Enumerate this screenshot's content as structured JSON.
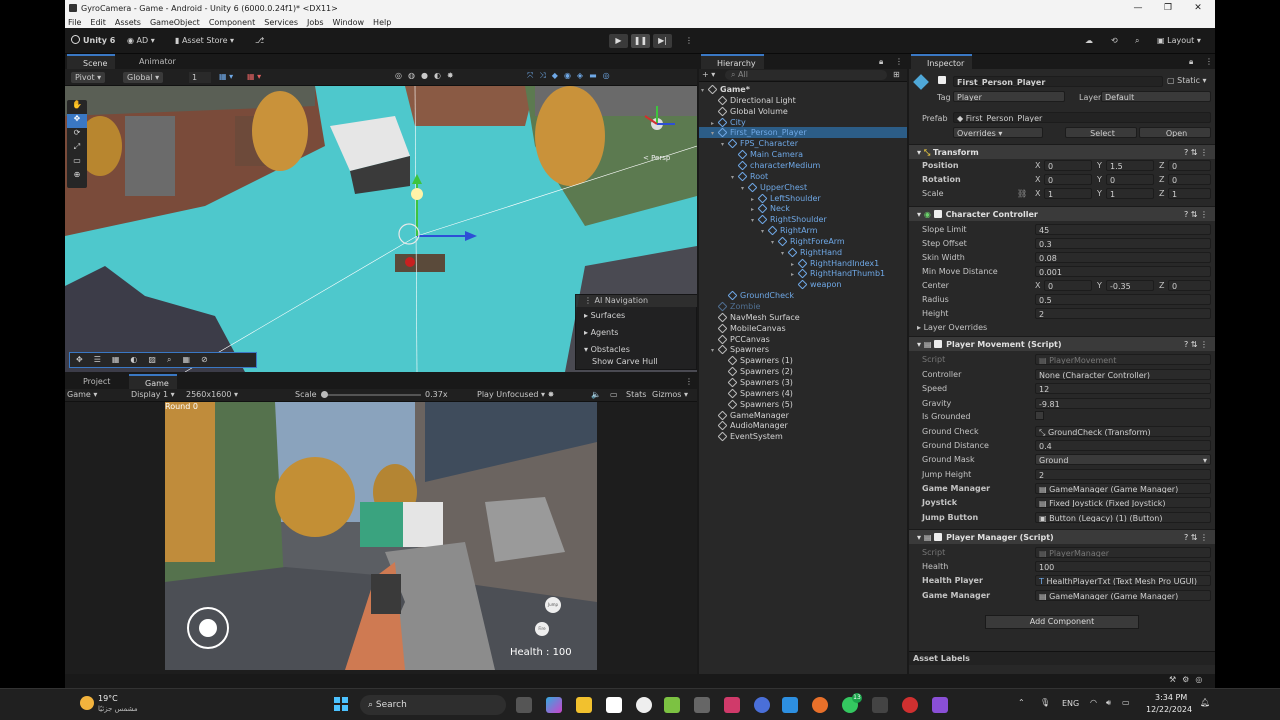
{
  "window": {
    "title": "GyroCamera - Game - Android - Unity 6 (6000.0.24f1)* <DX11>",
    "controls": [
      "—",
      "❐",
      "✕"
    ]
  },
  "menu": [
    "File",
    "Edit",
    "Assets",
    "GameObject",
    "Component",
    "Services",
    "Jobs",
    "Window",
    "Help"
  ],
  "toolbar": {
    "unity_label": "Unity 6",
    "account": "AD",
    "asset_store": "Asset Store",
    "layout": "Layout"
  },
  "scene_panel": {
    "tabs": [
      "Scene",
      "Animator"
    ],
    "pivot": "Pivot",
    "global": "Global",
    "grid_value": "1",
    "persp": "< Persp",
    "ai_nav": {
      "title": "AI Navigation",
      "items": [
        "Surfaces",
        "Agents",
        "Obstacles"
      ],
      "show_carve": "Show Carve Hull"
    }
  },
  "game_panel": {
    "tabs": [
      "Project",
      "Game"
    ],
    "mode": "Game",
    "display": "Display 1",
    "resolution": "2560x1600",
    "scale_label": "Scale",
    "scale_value": "0.37x",
    "play_unfocused": "Play Unfocused",
    "stats": "Stats",
    "gizmos": "Gizmos",
    "hud_round": "Round 0",
    "hud_health": "Health  : 100",
    "btn_jump": "Jump",
    "btn_fire": "Fire"
  },
  "hierarchy": {
    "tab": "Hierarchy",
    "search_placeholder": "All",
    "items": [
      {
        "label": "Game*",
        "depth": 0
      },
      {
        "label": "Directional Light",
        "depth": 1
      },
      {
        "label": "Global Volume",
        "depth": 1
      },
      {
        "label": "City",
        "depth": 1
      },
      {
        "label": "First_Person_Player",
        "depth": 1
      },
      {
        "label": "FPS_Character",
        "depth": 2
      },
      {
        "label": "Main Camera",
        "depth": 3
      },
      {
        "label": "characterMedium",
        "depth": 3
      },
      {
        "label": "Root",
        "depth": 3
      },
      {
        "label": "UpperChest",
        "depth": 4
      },
      {
        "label": "LeftShoulder",
        "depth": 5
      },
      {
        "label": "Neck",
        "depth": 5
      },
      {
        "label": "RightShoulder",
        "depth": 5
      },
      {
        "label": "RightArm",
        "depth": 6
      },
      {
        "label": "RightForeArm",
        "depth": 7
      },
      {
        "label": "RightHand",
        "depth": 8
      },
      {
        "label": "RightHandIndex1",
        "depth": 9
      },
      {
        "label": "RightHandThumb1",
        "depth": 9
      },
      {
        "label": "weapon",
        "depth": 9
      },
      {
        "label": "GroundCheck",
        "depth": 2
      },
      {
        "label": "Zombie",
        "depth": 1
      },
      {
        "label": "NavMesh Surface",
        "depth": 1
      },
      {
        "label": "MobileCanvas",
        "depth": 1
      },
      {
        "label": "PCCanvas",
        "depth": 1
      },
      {
        "label": "Spawners",
        "depth": 1
      },
      {
        "label": "Spawners (1)",
        "depth": 2
      },
      {
        "label": "Spawners (2)",
        "depth": 2
      },
      {
        "label": "Spawners (3)",
        "depth": 2
      },
      {
        "label": "Spawners (4)",
        "depth": 2
      },
      {
        "label": "Spawners (5)",
        "depth": 2
      },
      {
        "label": "GameManager",
        "depth": 1
      },
      {
        "label": "AudioManager",
        "depth": 1
      },
      {
        "label": "EventSystem",
        "depth": 1
      }
    ]
  },
  "inspector": {
    "tab": "Inspector",
    "object_name": "First_Person_Player",
    "static": "Static",
    "tag_label": "Tag",
    "tag_value": "Player",
    "layer_label": "Layer",
    "layer_value": "Default",
    "prefab_label": "Prefab",
    "prefab_value": "First_Person_Player",
    "overrides": "Overrides",
    "select": "Select",
    "open": "Open",
    "transform": {
      "title": "Transform",
      "rows": [
        {
          "label": "Position",
          "x": "0",
          "y": "1.5",
          "z": "0"
        },
        {
          "label": "Rotation",
          "x": "0",
          "y": "0",
          "z": "0"
        },
        {
          "label": "Scale",
          "x": "1",
          "y": "1",
          "z": "1"
        }
      ]
    },
    "character_controller": {
      "title": "Character Controller",
      "slope_limit": [
        "Slope Limit",
        "45"
      ],
      "step_offset": [
        "Step Offset",
        "0.3"
      ],
      "skin_width": [
        "Skin Width",
        "0.08"
      ],
      "min_move": [
        "Min Move Distance",
        "0.001"
      ],
      "center_label": "Center",
      "center": {
        "x": "0",
        "y": "-0.35",
        "z": "0"
      },
      "radius": [
        "Radius",
        "0.5"
      ],
      "height": [
        "Height",
        "2"
      ],
      "layer_overrides": "Layer Overrides"
    },
    "player_movement": {
      "title": "Player Movement (Script)",
      "script": [
        "Script",
        "PlayerMovement"
      ],
      "controller": [
        "Controller",
        "None (Character Controller)"
      ],
      "speed": [
        "Speed",
        "12"
      ],
      "gravity": [
        "Gravity",
        "-9.81"
      ],
      "is_grounded": "Is Grounded",
      "ground_check": [
        "Ground Check",
        "GroundCheck (Transform)"
      ],
      "ground_distance": [
        "Ground Distance",
        "0.4"
      ],
      "ground_mask": [
        "Ground Mask",
        "Ground"
      ],
      "jump_height": [
        "Jump Height",
        "2"
      ],
      "game_manager": [
        "Game Manager",
        "GameManager (Game Manager)"
      ],
      "joystick": [
        "Joystick",
        "Fixed Joystick (Fixed Joystick)"
      ],
      "jump_button": [
        "Jump Button",
        "Button (Legacy) (1) (Button)"
      ]
    },
    "player_manager": {
      "title": "Player Manager (Script)",
      "script": [
        "Script",
        "PlayerManager"
      ],
      "health": [
        "Health",
        "100"
      ],
      "health_player": [
        "Health Player",
        "HealthPlayerTxt (Text Mesh Pro UGUI)"
      ],
      "game_manager": [
        "Game Manager",
        "GameManager (Game Manager)"
      ]
    },
    "add_component": "Add Component",
    "asset_labels": "Asset Labels"
  },
  "taskbar": {
    "weather_temp": "19°C",
    "weather_desc": "مشمس جزئيًا",
    "search": "Search",
    "lang": "ENG",
    "time": "3:34 PM",
    "date": "12/22/2024",
    "badge": "13"
  },
  "colors": {
    "accent_blue": "#3a78c4",
    "prefab_blue": "#6fa8e6",
    "scene_water": "#4ec8cc"
  }
}
